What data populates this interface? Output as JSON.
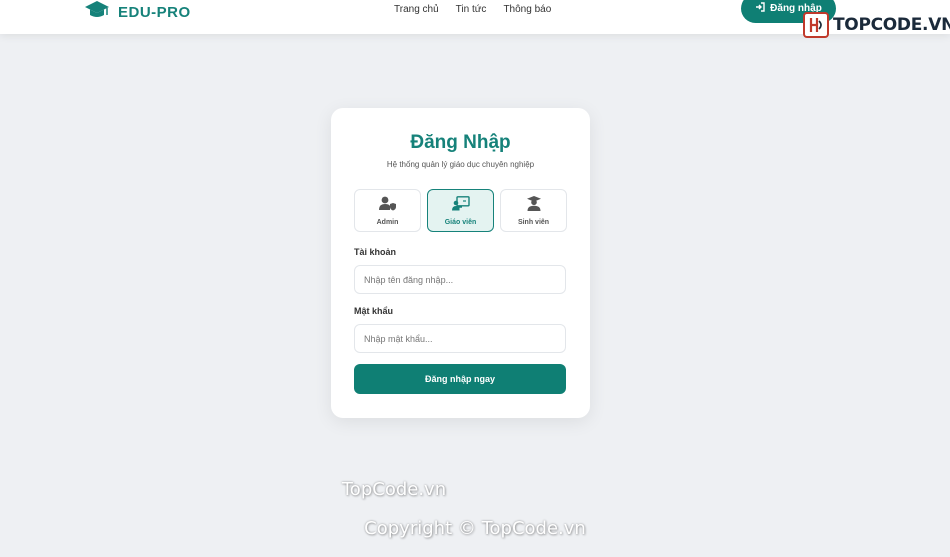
{
  "header": {
    "brand": "EDU-PRO",
    "nav": [
      "Trang chủ",
      "Tin tức",
      "Thông báo"
    ],
    "login_button": "Đăng nhập"
  },
  "watermark": {
    "logo_text": "TOPCODE.VN",
    "center_text": "TopCode.vn",
    "copyright": "Copyright © TopCode.vn"
  },
  "login_card": {
    "title": "Đăng Nhập",
    "subtitle": "Hệ thống quản lý giáo dục chuyên nghiệp",
    "roles": [
      {
        "label": "Admin",
        "icon": "user-shield-icon",
        "active": false
      },
      {
        "label": "Giáo viên",
        "icon": "chalkboard-teacher-icon",
        "active": true
      },
      {
        "label": "Sinh viên",
        "icon": "user-graduate-icon",
        "active": false
      }
    ],
    "username": {
      "label": "Tài khoản",
      "placeholder": "Nhập tên đăng nhập...",
      "value": ""
    },
    "password": {
      "label": "Mật khẩu",
      "placeholder": "Nhập mật khẩu...",
      "value": ""
    },
    "submit": "Đăng nhập ngay"
  },
  "colors": {
    "primary": "#0f7f74",
    "brand_text": "#16827a",
    "background": "#eef0f3"
  }
}
